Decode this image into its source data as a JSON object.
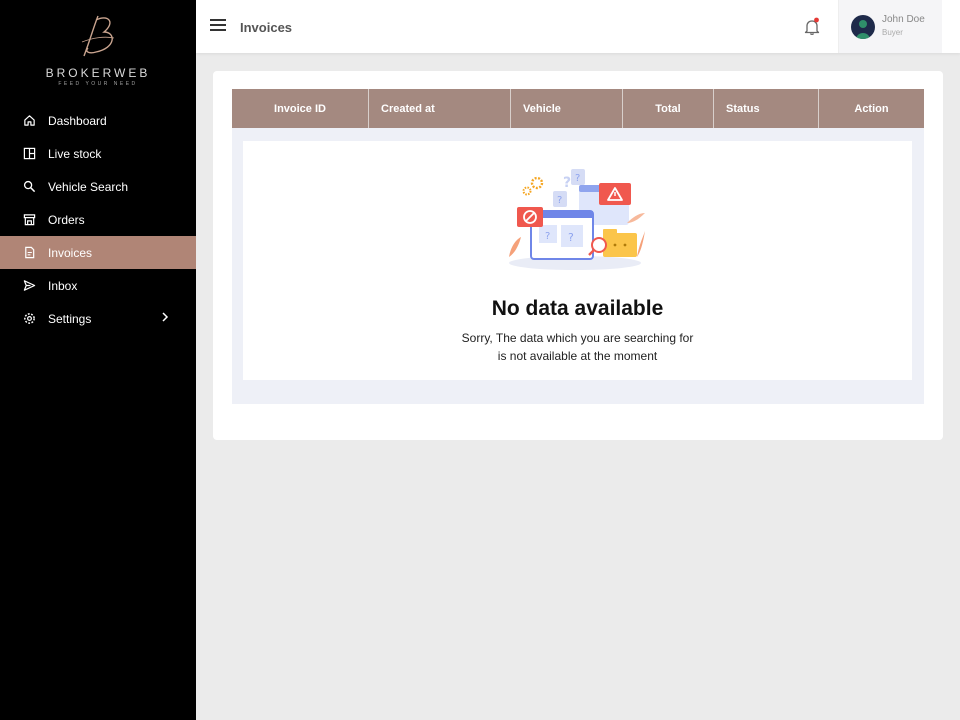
{
  "brand": {
    "name": "BROKERWEB",
    "tagline": "FEED YOUR NEED"
  },
  "sidebar": {
    "items": [
      {
        "label": "Dashboard",
        "icon": "home-icon"
      },
      {
        "label": "Live stock",
        "icon": "grid-icon"
      },
      {
        "label": "Vehicle Search",
        "icon": "search-icon"
      },
      {
        "label": "Orders",
        "icon": "store-icon"
      },
      {
        "label": "Invoices",
        "icon": "document-icon",
        "active": true
      },
      {
        "label": "Inbox",
        "icon": "send-icon"
      },
      {
        "label": "Settings",
        "icon": "gear-icon",
        "expandable": true
      }
    ]
  },
  "header": {
    "title": "Invoices",
    "user": {
      "name": "John Doe",
      "role": "Buyer"
    }
  },
  "table": {
    "columns": [
      "Invoice ID",
      "Created at",
      "Vehicle",
      "Total",
      "Status",
      "Action"
    ]
  },
  "empty_state": {
    "title": "No data available",
    "line1": "Sorry, The data which you are searching for",
    "line2": "is not available at the moment"
  },
  "colors": {
    "sidebar_bg": "#000000",
    "active_item": "#b08576",
    "table_header": "#a48980",
    "notification_dot": "#e53935"
  }
}
